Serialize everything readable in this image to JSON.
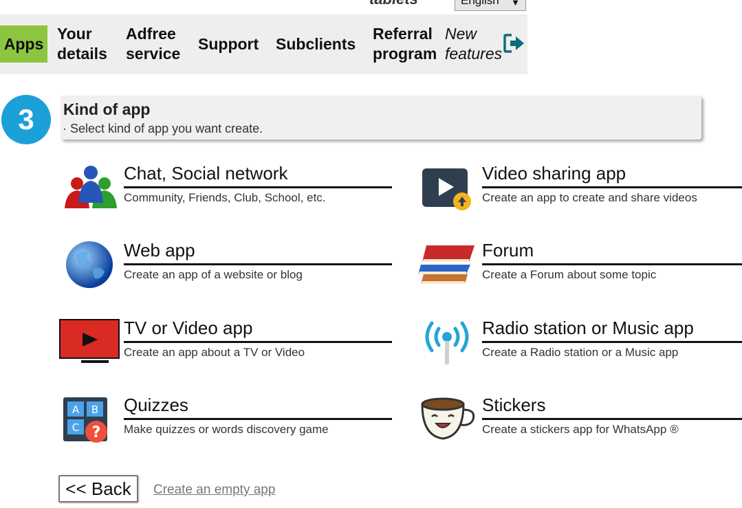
{
  "header": {
    "cut_text": "tablets",
    "language": {
      "selected": "English"
    }
  },
  "nav": {
    "items": [
      {
        "label": "Apps"
      },
      {
        "label": "Your details"
      },
      {
        "label": "Adfree service"
      },
      {
        "label": "Support"
      },
      {
        "label": "Subclients"
      },
      {
        "label": "Referral program"
      },
      {
        "label": "New features"
      }
    ],
    "active_color": "#8cc53f"
  },
  "step": {
    "number": "3",
    "title": "Kind of app",
    "subtitle": "· Select kind of app you want create.",
    "circle_color": "#1ba0d8"
  },
  "apps": [
    {
      "title": "Chat, Social network",
      "desc": "Community, Friends, Club, School, etc.",
      "icon": "people-icon"
    },
    {
      "title": "Video sharing app",
      "desc": "Create an app to create and share videos",
      "icon": "video-upload-icon"
    },
    {
      "title": "Web app",
      "desc": "Create an app of a website or blog",
      "icon": "globe-icon"
    },
    {
      "title": "Forum",
      "desc": "Create a Forum about some topic",
      "icon": "books-icon"
    },
    {
      "title": "TV or Video app",
      "desc": "Create an app about a TV or Video",
      "icon": "tv-icon"
    },
    {
      "title": "Radio station or Music app",
      "desc": "Create a Radio station or a Music app",
      "icon": "radio-antenna-icon"
    },
    {
      "title": "Quizzes",
      "desc": "Make quizzes or words discovery game",
      "icon": "quiz-icon"
    },
    {
      "title": "Stickers",
      "desc": "Create a stickers app for WhatsApp ®",
      "icon": "coffee-cup-icon"
    }
  ],
  "footer": {
    "back_label": "<< Back",
    "empty_app_label": "Create an empty app"
  }
}
